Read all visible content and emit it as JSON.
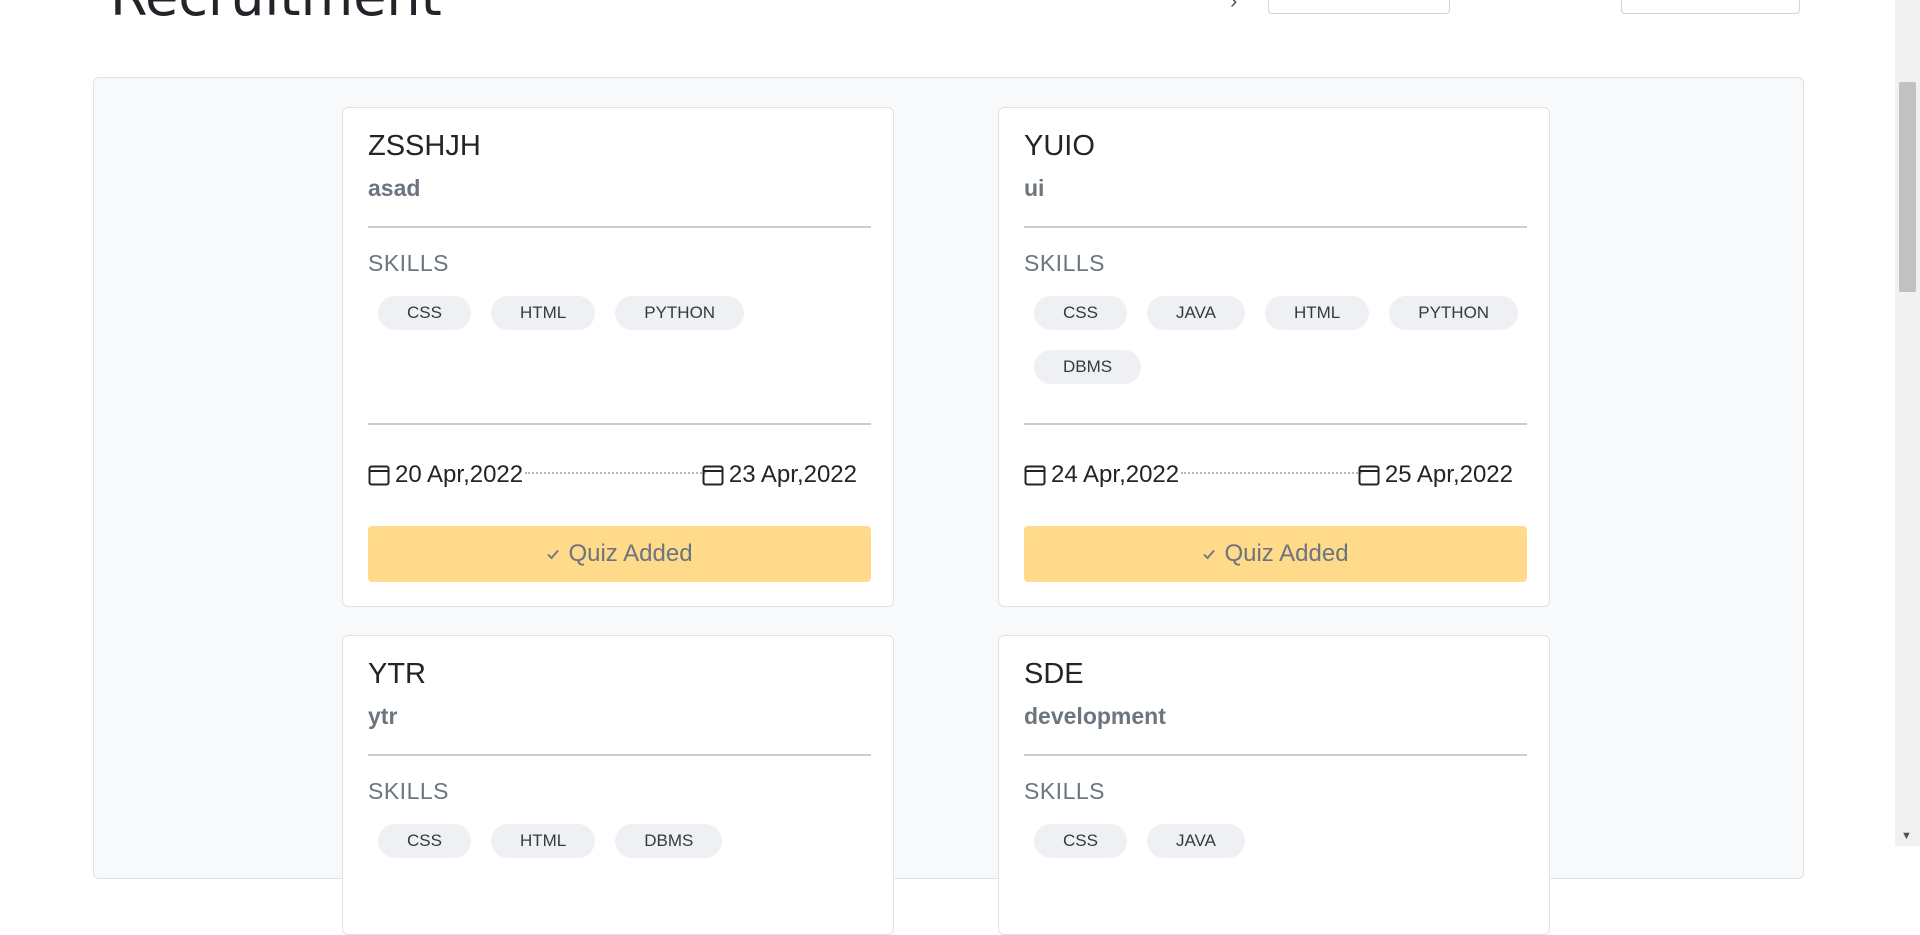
{
  "header": {
    "title": "Recruitment"
  },
  "skills_label": "SKILLS",
  "cards": [
    {
      "title": "ZSSHJH",
      "subtitle": "asad",
      "skills": [
        "CSS",
        "HTML",
        "PYTHON"
      ],
      "start_date": "20 Apr,2022",
      "end_date": "23 Apr,2022",
      "button_label": "Quiz Added"
    },
    {
      "title": "YUIO",
      "subtitle": "ui",
      "skills": [
        "CSS",
        "JAVA",
        "HTML",
        "PYTHON",
        "DBMS"
      ],
      "start_date": "24 Apr,2022",
      "end_date": "25 Apr,2022",
      "button_label": "Quiz Added"
    },
    {
      "title": "YTR",
      "subtitle": "ytr",
      "skills": [
        "CSS",
        "HTML",
        "DBMS"
      ]
    },
    {
      "title": "SDE",
      "subtitle": "development",
      "skills": [
        "CSS",
        "JAVA"
      ]
    }
  ],
  "colors": {
    "button_bg": "#ffda8a",
    "chip_bg": "#eef0f4",
    "container_bg": "#f8f9fa"
  },
  "icons": {
    "date": "calendar-icon",
    "button": "check-icon"
  }
}
